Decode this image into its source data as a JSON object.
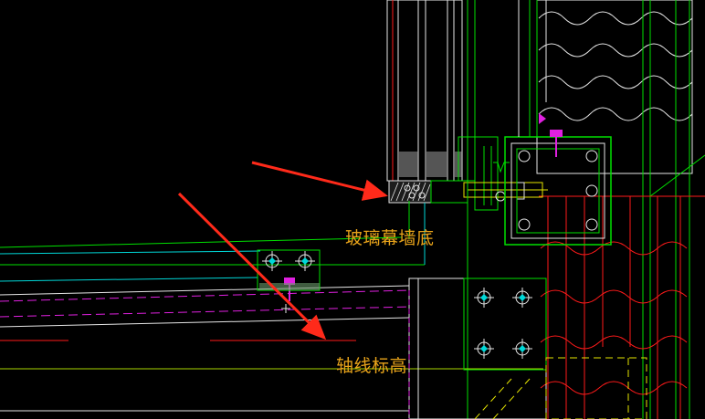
{
  "annotations": {
    "glass_curtain_wall_bottom": "玻璃幕墙底",
    "axis_elevation": "轴线标高"
  },
  "colors": {
    "background": "#000000",
    "annotation_text": "#e8a31a",
    "arrow": "#ff2a1a",
    "line_green": "#00e000",
    "line_cyan": "#00d8d8",
    "line_white": "#e6e6e6",
    "line_red": "#ff1a1a",
    "line_magenta": "#e020e0",
    "line_yellow": "#e6e600",
    "line_yellowgreen": "#a8d400"
  },
  "icons": {
    "bolt_marker": "bolt-crosshair-icon",
    "cursor": "crosshair-cursor-icon"
  }
}
